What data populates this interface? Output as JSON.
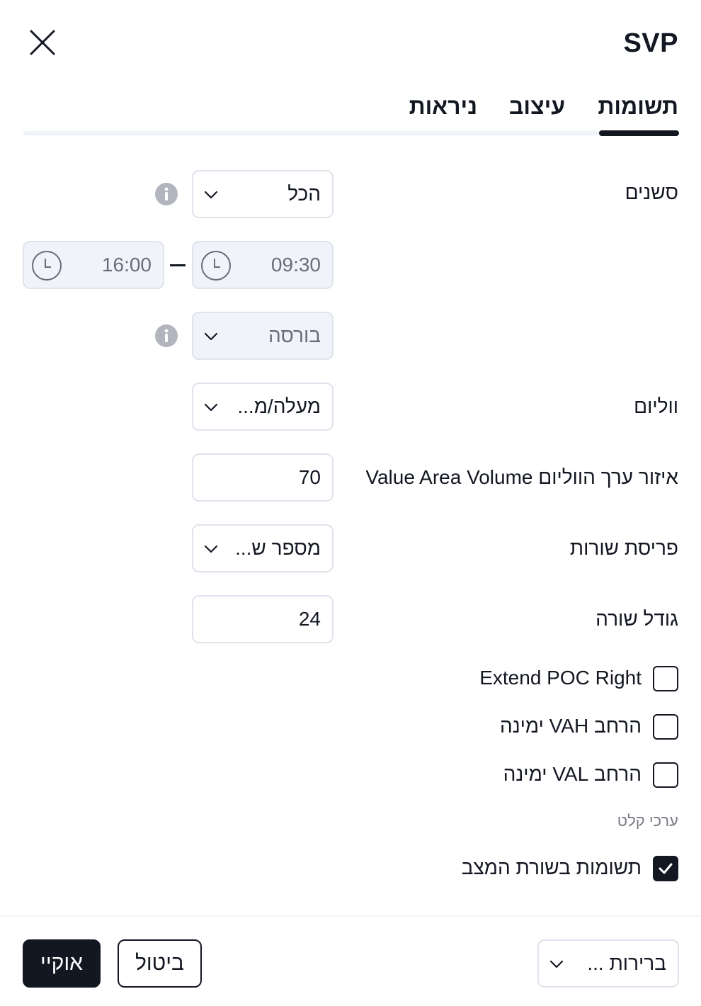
{
  "dialog": {
    "title": "SVP"
  },
  "tabs": [
    {
      "label": "תשומות",
      "active": true
    },
    {
      "label": "עיצוב",
      "active": false
    },
    {
      "label": "ניראות",
      "active": false
    }
  ],
  "inputs": {
    "sessions": {
      "label": "סשנים",
      "value": "הכל"
    },
    "session_time": {
      "start": "09:30",
      "end": "16:00"
    },
    "exchange": {
      "value": "בורסה"
    },
    "volume": {
      "label": "ווליום",
      "value": "מעלה/מ..."
    },
    "value_area": {
      "label": "איזור ערך הווליום Value Area Volume",
      "value": "70"
    },
    "row_layout": {
      "label": "פריסת שורות",
      "value": "מספר ש..."
    },
    "row_size": {
      "label": "גודל שורה",
      "value": "24"
    }
  },
  "checkboxes": {
    "extend_poc": {
      "label": "Extend POC Right",
      "checked": false
    },
    "extend_vah": {
      "label": "הרחב VAH ימינה",
      "checked": false
    },
    "extend_val": {
      "label": "הרחב VAL ימינה",
      "checked": false
    },
    "inputs_in_status": {
      "label": "תשומות בשורת המצב",
      "checked": true
    }
  },
  "section_hint": "ערכי קלט",
  "footer": {
    "defaults_label": "ברירות ...",
    "cancel_label": "ביטול",
    "ok_label": "אוקיי"
  },
  "colors": {
    "text": "#131722",
    "border": "#e0e3eb",
    "disabled_bg": "#f0f3fa",
    "hint": "#787b86",
    "info_icon": "#b2b5be"
  }
}
